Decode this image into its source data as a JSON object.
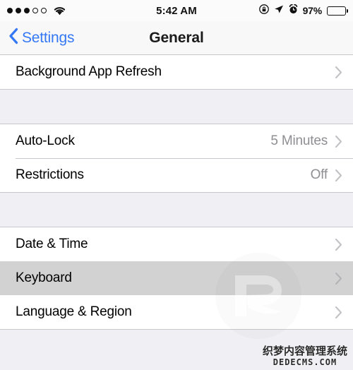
{
  "status_bar": {
    "signal_dots_filled": 3,
    "signal_dots_empty": 2,
    "wifi_icon": "wifi-icon",
    "time": "5:42 AM",
    "rotation_lock_icon": "rotation-lock-icon",
    "location_icon": "location-arrow-icon",
    "alarm_icon": "alarm-clock-icon",
    "battery_percent": "97%",
    "battery_level": 97
  },
  "nav_bar": {
    "back_label": "Settings",
    "back_icon": "chevron-left-icon",
    "title": "General",
    "accent_color": "#3478f6"
  },
  "sections": [
    {
      "rows": [
        {
          "label": "Background App Refresh",
          "value": "",
          "accessory": "chevron-right-icon",
          "selected": false
        }
      ]
    },
    {
      "rows": [
        {
          "label": "Auto-Lock",
          "value": "5 Minutes",
          "accessory": "chevron-right-icon",
          "selected": false
        },
        {
          "label": "Restrictions",
          "value": "Off",
          "accessory": "chevron-right-icon",
          "selected": false
        }
      ]
    },
    {
      "rows": [
        {
          "label": "Date & Time",
          "value": "",
          "accessory": "chevron-right-icon",
          "selected": false
        },
        {
          "label": "Keyboard",
          "value": "",
          "accessory": "chevron-right-icon",
          "selected": true
        },
        {
          "label": "Language & Region",
          "value": "",
          "accessory": "chevron-right-icon",
          "selected": false
        }
      ]
    }
  ],
  "watermark": {
    "logo_icon": "r-logo-watermark",
    "text_cn": "织梦内容管理系统",
    "text_en": "DEDECMS.COM"
  },
  "colors": {
    "background": "#efeff4",
    "row_background": "#ffffff",
    "row_selected": "#d2d2d2",
    "separator": "#c8c7cc",
    "value_text": "#8e8e93",
    "accent": "#3478f6"
  }
}
